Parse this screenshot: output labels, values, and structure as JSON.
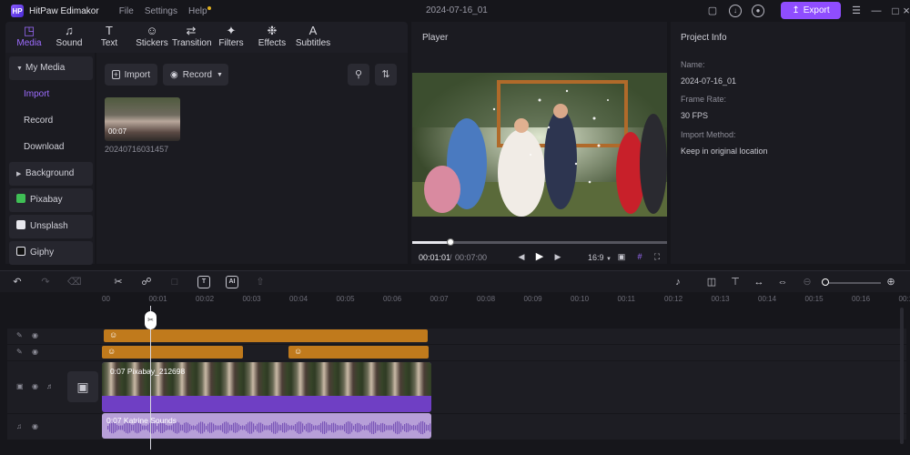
{
  "app": {
    "name": "HitPaw Edimakor",
    "logo_text": "HP",
    "menus": [
      "File",
      "Settings",
      "Help"
    ],
    "project_title": "2024-07-16_01",
    "export_label": "Export"
  },
  "tool_tabs": [
    "Media",
    "Sound",
    "Text",
    "Stickers",
    "Transition",
    "Filters",
    "Effects",
    "Subtitles"
  ],
  "sidebar": {
    "my_media": "My Media",
    "items": [
      "Import",
      "Record",
      "Download"
    ],
    "background": "Background",
    "sources": [
      "Pixabay",
      "Unsplash",
      "Giphy"
    ]
  },
  "media": {
    "import_label": "Import",
    "record_label": "Record",
    "thumb_duration": "00:07",
    "thumb_name": "20240716031457"
  },
  "player": {
    "title": "Player",
    "current_time": "00:01:01",
    "separator": "/",
    "total_time": "00:07:00",
    "aspect": "16:9",
    "progress": 0.15
  },
  "project_info": {
    "title": "Project Info",
    "name_label": "Name:",
    "name_value": "2024-07-16_01",
    "frame_rate_label": "Frame Rate:",
    "frame_rate_value": "30 FPS",
    "import_method_label": "Import Method:",
    "import_method_value": "Keep in original location"
  },
  "timeline": {
    "ruler_ticks": [
      "00",
      "00:01",
      "00:02",
      "00:03",
      "00:04",
      "00:05",
      "00:06",
      "00:07",
      "00:08",
      "00:09",
      "00:10",
      "00:11",
      "00:12",
      "00:13",
      "00:14",
      "00:15",
      "00:16",
      "00:17"
    ],
    "video_clip_label": "0:07 Pixabay_212698",
    "audio_clip_label": "0:07 Katrine Sounds",
    "tool_text_label": "T",
    "tool_ai_label": "AI",
    "zoom_level": 0.05
  },
  "colors": {
    "accent": "#8f4dff",
    "sticker_clip": "#c07a1c",
    "video_clip": "#6f3fc4",
    "audio_clip": "#b79fd8"
  }
}
